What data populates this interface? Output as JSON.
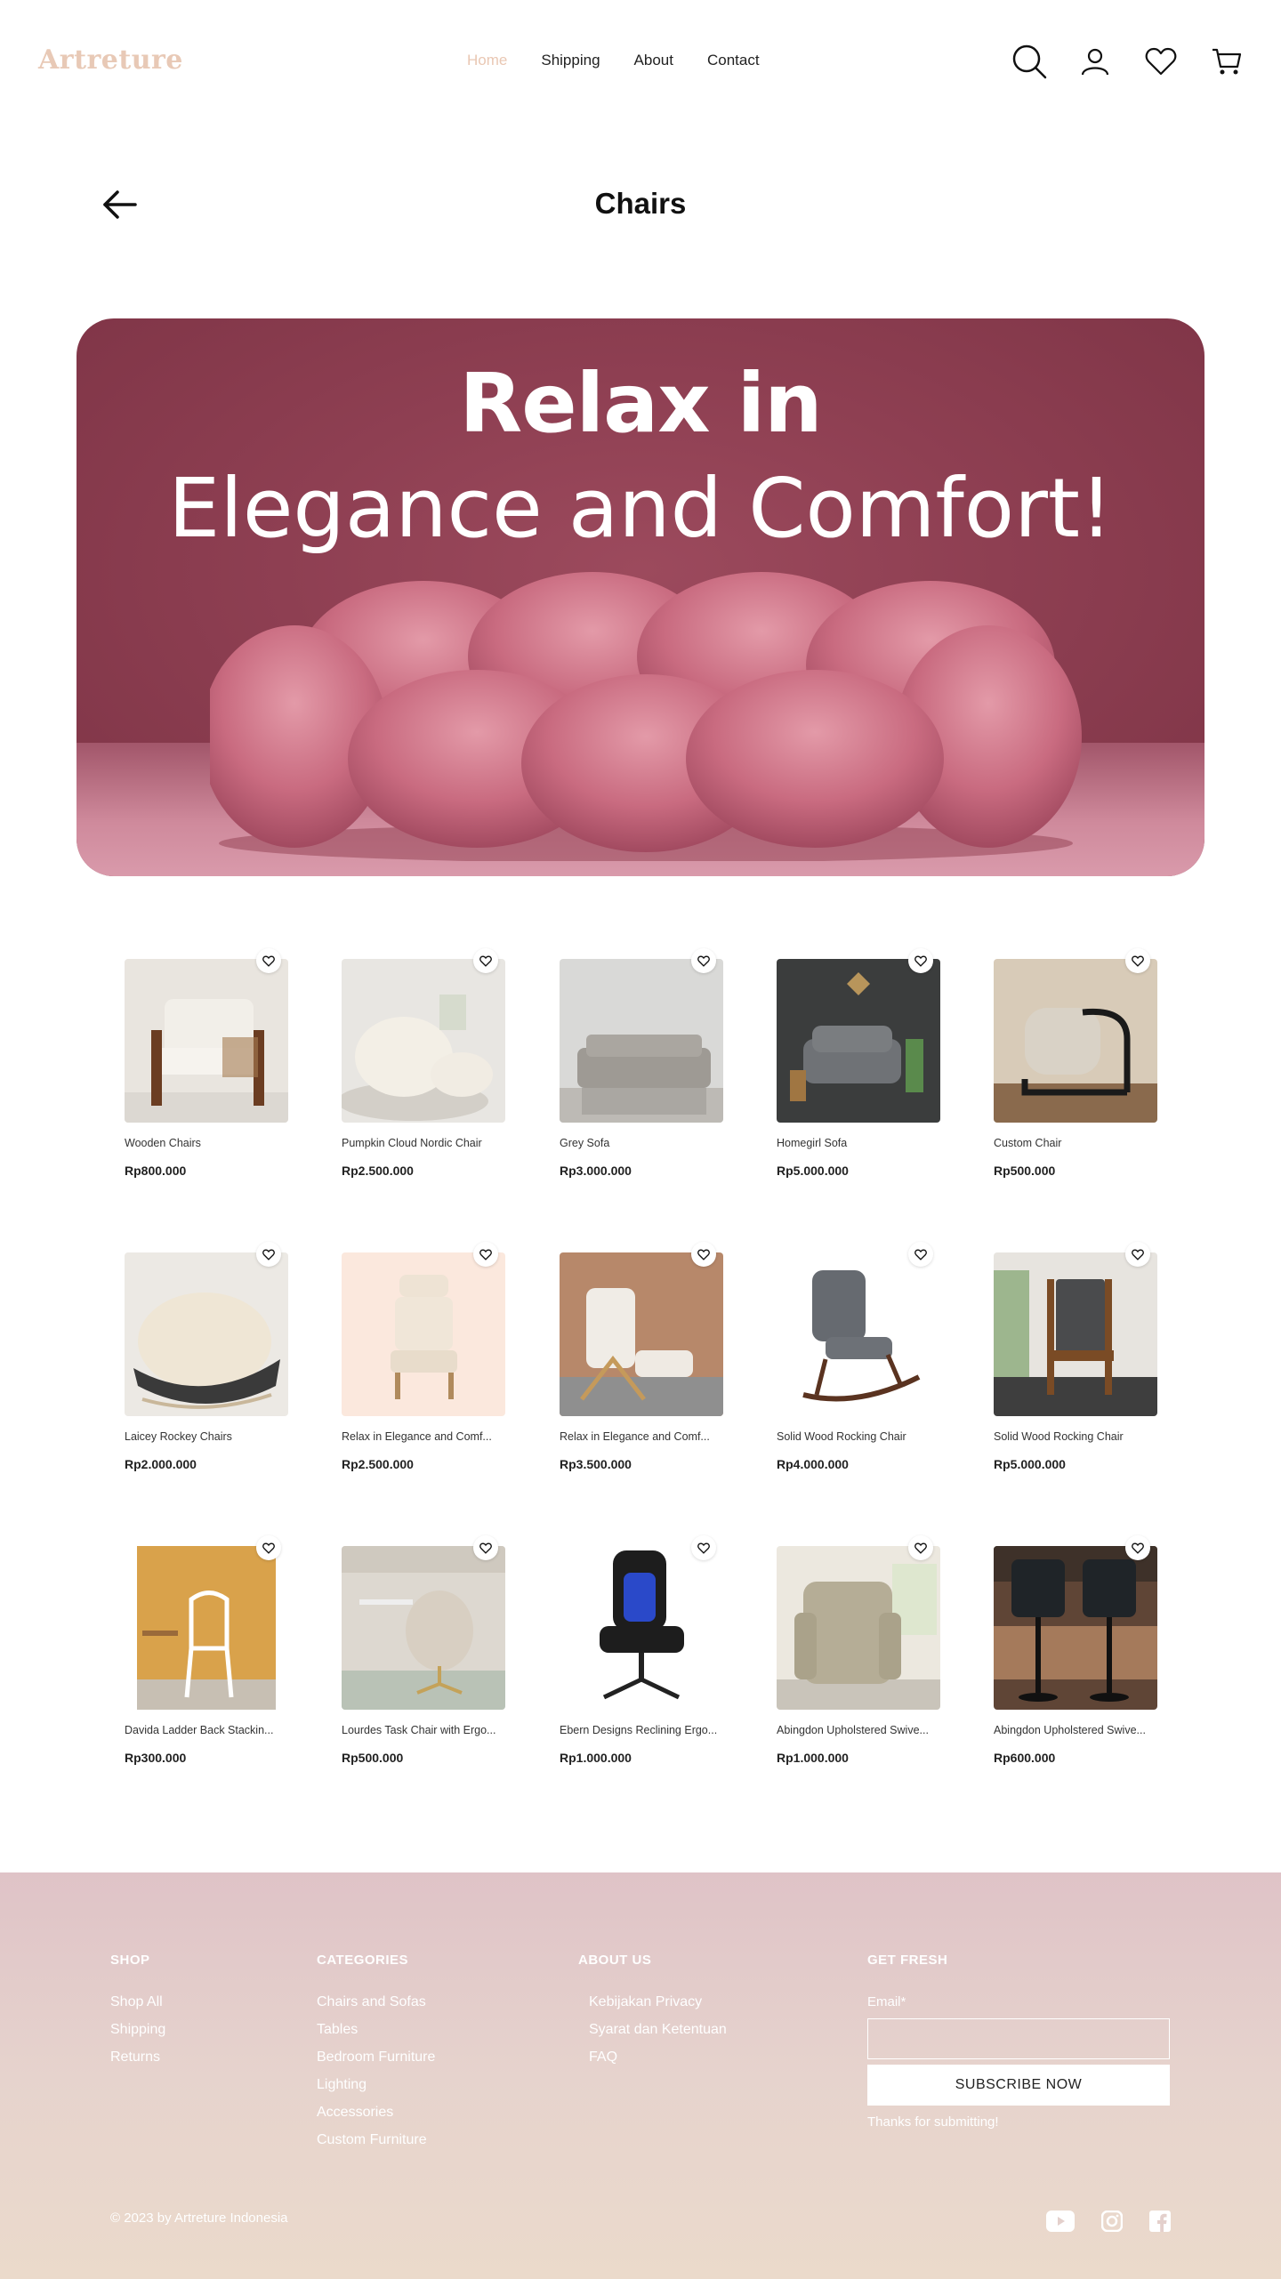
{
  "header": {
    "logo": "Artreture",
    "nav": [
      "Home",
      "Shipping",
      "About",
      "Contact"
    ]
  },
  "page": {
    "title": "Chairs"
  },
  "hero": {
    "line1": "Relax in",
    "line2": "Elegance and Comfort!"
  },
  "products": [
    {
      "name": "Wooden Chairs",
      "price": "Rp800.000"
    },
    {
      "name": "Pumpkin Cloud Nordic Chair",
      "price": "Rp2.500.000"
    },
    {
      "name": "Grey Sofa",
      "price": "Rp3.000.000"
    },
    {
      "name": "Homegirl Sofa",
      "price": "Rp5.000.000"
    },
    {
      "name": "Custom Chair",
      "price": "Rp500.000"
    },
    {
      "name": "Laicey Rockey Chairs",
      "price": "Rp2.000.000"
    },
    {
      "name": "Relax in Elegance and Comf...",
      "price": "Rp2.500.000"
    },
    {
      "name": "Relax in Elegance and Comf...",
      "price": "Rp3.500.000"
    },
    {
      "name": "Solid Wood Rocking Chair",
      "price": "Rp4.000.000"
    },
    {
      "name": "Solid Wood Rocking Chair",
      "price": "Rp5.000.000"
    },
    {
      "name": "Davida Ladder Back Stackin...",
      "price": "Rp300.000"
    },
    {
      "name": "Lourdes Task Chair with Ergo...",
      "price": "Rp500.000"
    },
    {
      "name": "Ebern Designs Reclining Ergo...",
      "price": "Rp1.000.000"
    },
    {
      "name": "Abingdon Upholstered Swive...",
      "price": "Rp1.000.000"
    },
    {
      "name": "Abingdon Upholstered Swive...",
      "price": "Rp600.000"
    }
  ],
  "footer": {
    "shop": {
      "title": "SHOP",
      "links": [
        "Shop All",
        "Shipping",
        "Returns"
      ]
    },
    "categories": {
      "title": "CATEGORIES",
      "links": [
        "Chairs and Sofas",
        "Tables",
        "Bedroom Furniture",
        "Lighting",
        "Accessories",
        "Custom Furniture"
      ]
    },
    "about": {
      "title": "ABOUT US",
      "links": [
        "Kebijakan Privacy",
        "Syarat dan Ketentuan",
        "FAQ"
      ]
    },
    "fresh": {
      "title": "GET FRESH",
      "email_label": "Email*",
      "button": "SUBSCRIBE NOW",
      "thanks": "Thanks for submitting!"
    },
    "copyright": "© 2023 by Artreture Indonesia"
  },
  "colors": {
    "logo": "#e8c9b6",
    "nav_active": "#e9c7b3",
    "hero_bg": "#8e3f52",
    "footer_top": "#dfc3c7",
    "footer_bottom": "#ebdacb"
  }
}
